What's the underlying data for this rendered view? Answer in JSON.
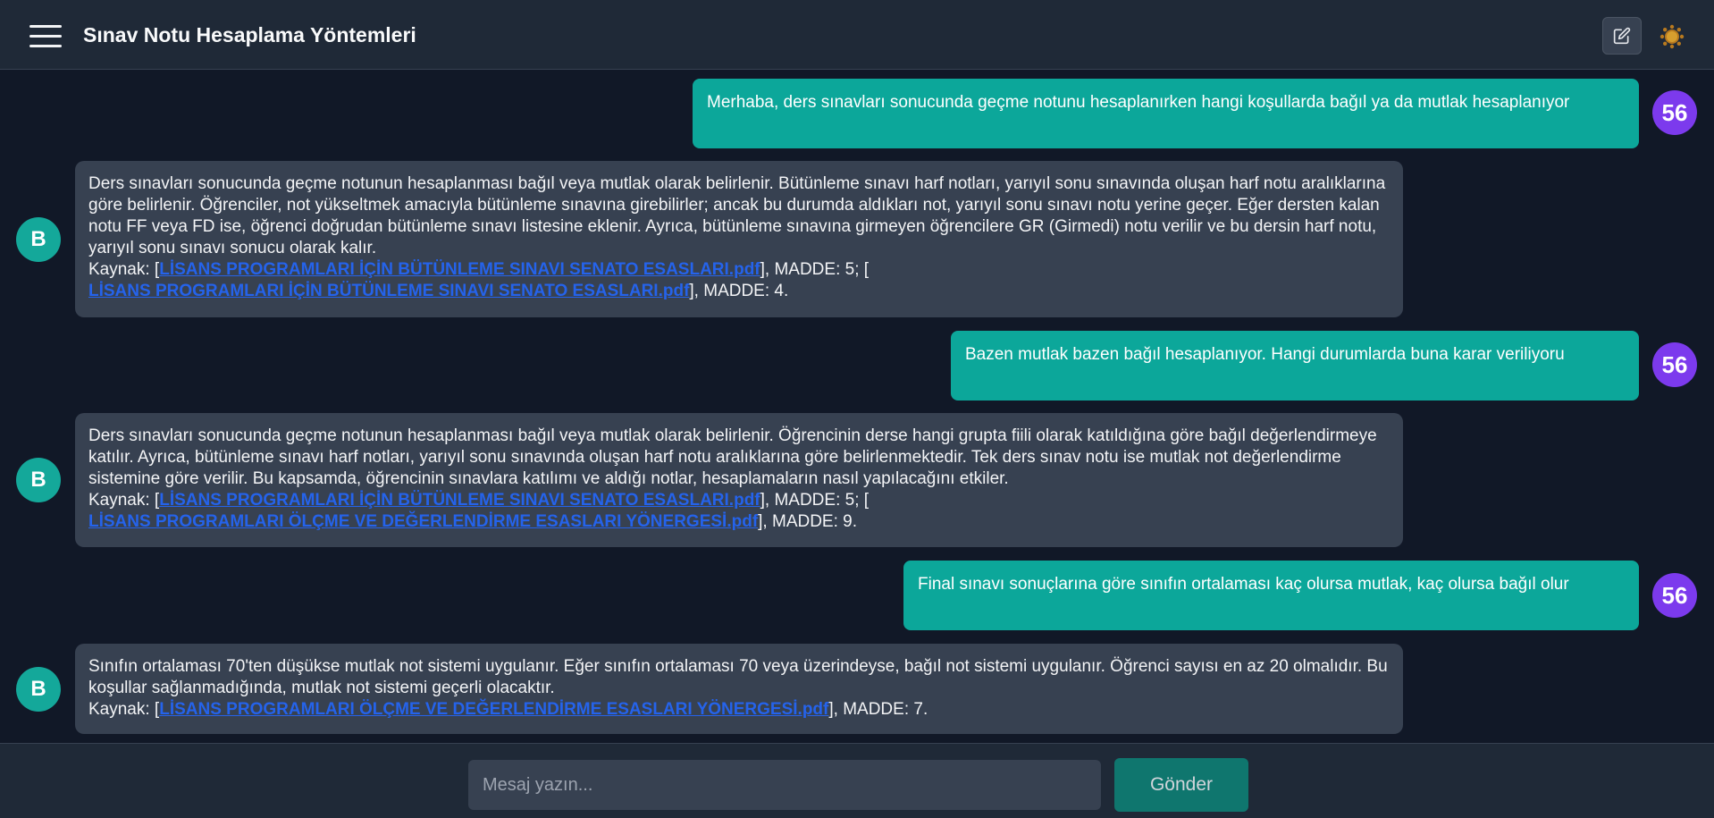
{
  "header": {
    "title": "Sınav Notu Hesaplama Yöntemleri"
  },
  "user": {
    "avatar_label": "56"
  },
  "bot": {
    "avatar_label": "B"
  },
  "messages": [
    {
      "role": "user",
      "text": "Merhaba, ders sınavları sonucunda geçme notunu hesaplanırken hangi koşullarda bağıl ya da mutlak hesaplanıyor"
    },
    {
      "role": "bot",
      "text": "Ders sınavları sonucunda geçme notunun hesaplanması bağıl veya mutlak olarak belirlenir. Bütünleme sınavı harf notları, yarıyıl sonu sınavında oluşan harf notu aralıklarına göre belirlenir. Öğrenciler, not yükseltmek amacıyla bütünleme sınavına girebilirler; ancak bu durumda aldıkları not, yarıyıl sonu sınavı notu yerine geçer. Eğer dersten kalan notu FF veya FD ise, öğrenci doğrudan bütünleme sınavı listesine eklenir. Ayrıca, bütünleme sınavına girmeyen öğrencilere GR (Girmedi) notu verilir ve bu dersin harf notu, yarıyıl sonu sınavı sonucu olarak kalır.",
      "source_prefix": "Kaynak: [",
      "link1": "LİSANS PROGRAMLARI İÇİN BÜTÜNLEME SINAVI SENATO ESASLARI.pdf",
      "mid": "], MADDE: 5; [",
      "link2": "LİSANS PROGRAMLARI İÇİN BÜTÜNLEME SINAVI SENATO ESASLARI.pdf",
      "suffix": "], MADDE: 4."
    },
    {
      "role": "user",
      "text": "Bazen mutlak bazen bağıl hesaplanıyor. Hangi durumlarda buna karar veriliyoru"
    },
    {
      "role": "bot",
      "text": "Ders sınavları sonucunda geçme notunun hesaplanması bağıl veya mutlak olarak belirlenir. Öğrencinin derse hangi grupta fiili olarak katıldığına göre bağıl değerlendirmeye katılır. Ayrıca, bütünleme sınavı harf notları, yarıyıl sonu sınavında oluşan harf notu aralıklarına göre belirlenmektedir. Tek ders sınav notu ise mutlak not değerlendirme sistemine göre verilir. Bu kapsamda, öğrencinin sınavlara katılımı ve aldığı notlar, hesaplamaların nasıl yapılacağını etkiler.",
      "source_prefix": "Kaynak: [",
      "link1": "LİSANS PROGRAMLARI İÇİN BÜTÜNLEME SINAVI SENATO ESASLARI.pdf",
      "mid": "], MADDE: 5; [",
      "link2": "LİSANS PROGRAMLARI ÖLÇME VE DEĞERLENDİRME ESASLARI YÖNERGESİ.pdf",
      "suffix": "], MADDE: 9."
    },
    {
      "role": "user",
      "text": "Final sınavı sonuçlarına göre sınıfın ortalaması kaç olursa mutlak, kaç olursa bağıl olur"
    },
    {
      "role": "bot",
      "text": "Sınıfın ortalaması 70'ten düşükse mutlak not sistemi uygulanır. Eğer sınıfın ortalaması 70 veya üzerindeyse, bağıl not sistemi uygulanır. Öğrenci sayısı en az 20 olmalıdır. Bu koşullar sağlanmadığında, mutlak not sistemi geçerli olacaktır.",
      "source_prefix": "Kaynak: [",
      "link1": "LİSANS PROGRAMLARI ÖLÇME VE DEĞERLENDİRME ESASLARI YÖNERGESİ.pdf",
      "suffix": "], MADDE: 7."
    }
  ],
  "composer": {
    "placeholder": "Mesaj yazın...",
    "send_label": "Gönder"
  },
  "icons": {
    "menu": "hamburger-menu-icon",
    "edit": "edit-icon",
    "theme": "sun-icon"
  },
  "colors": {
    "user_bubble": "#0ca79a",
    "bot_bubble": "#374151",
    "user_avatar": "#7c3aed",
    "bot_avatar": "#14a89a",
    "link": "#2563eb",
    "send_button": "#0f766e"
  }
}
